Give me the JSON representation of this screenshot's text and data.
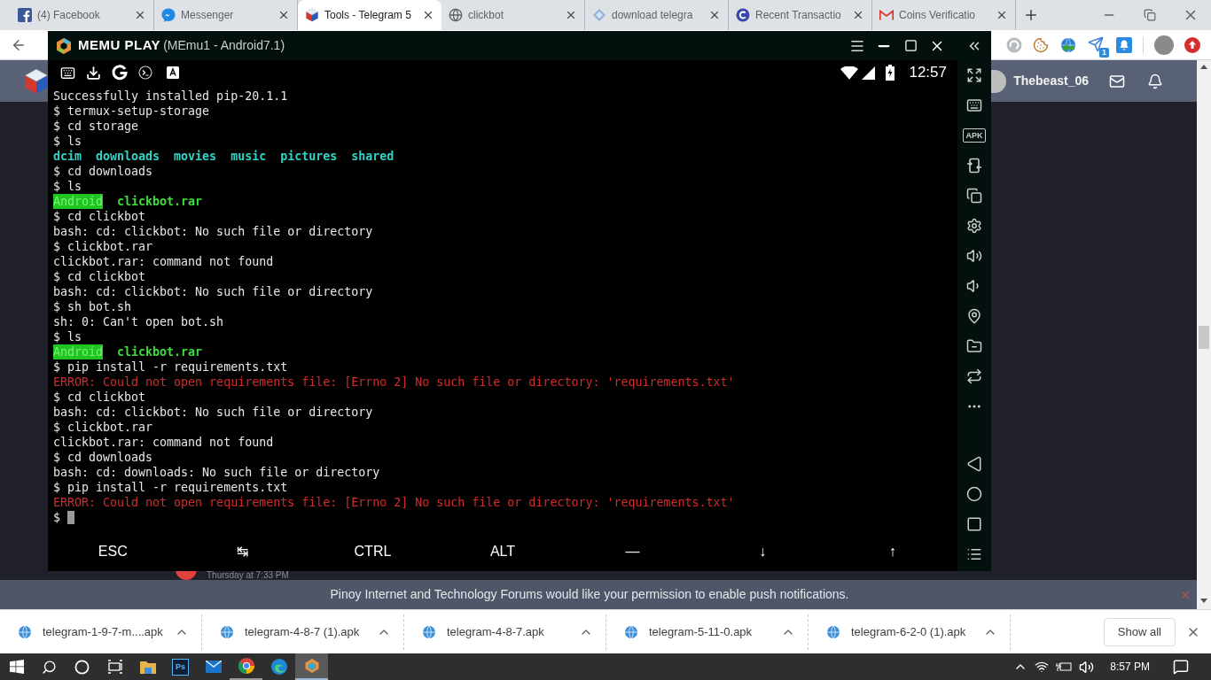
{
  "browser": {
    "tabs": [
      {
        "title": "(4) Facebook",
        "selected": false
      },
      {
        "title": "Messenger",
        "selected": false
      },
      {
        "title": "Tools - Telegram 5",
        "selected": true
      },
      {
        "title": "clickbot",
        "selected": false
      },
      {
        "title": "download telegra",
        "selected": false
      },
      {
        "title": "Recent Transactio",
        "selected": false
      },
      {
        "title": "Coins Verificatio",
        "selected": false
      }
    ],
    "extension_badge": "1"
  },
  "forum": {
    "username": "Thebeast_06",
    "post_time": "Thursday at 7:33 PM",
    "notification": "Pinoy Internet and Technology Forums would like your permission to enable push notifications."
  },
  "emulator": {
    "brand": "MEMU PLAY",
    "title": "(MEmu1 - Android7.1)",
    "clock": "12:57",
    "apk_label": "APK",
    "terminal": [
      {
        "kind": "plain",
        "text": "Successfully installed pip-20.1.1"
      },
      {
        "kind": "plain",
        "text": "$ termux-setup-storage"
      },
      {
        "kind": "plain",
        "text": "$ cd storage"
      },
      {
        "kind": "plain",
        "text": "$ ls"
      },
      {
        "kind": "listing",
        "entries": [
          {
            "kind": "dir",
            "name": "dcim"
          },
          {
            "kind": "dir",
            "name": "downloads"
          },
          {
            "kind": "dir",
            "name": "movies"
          },
          {
            "kind": "dir",
            "name": "music"
          },
          {
            "kind": "dir",
            "name": "pictures"
          },
          {
            "kind": "dir",
            "name": "shared"
          }
        ]
      },
      {
        "kind": "plain",
        "text": "$ cd downloads"
      },
      {
        "kind": "plain",
        "text": "$ ls"
      },
      {
        "kind": "listing",
        "entries": [
          {
            "kind": "highlighted",
            "name": "Android"
          },
          {
            "kind": "archive",
            "name": "clickbot.rar"
          }
        ]
      },
      {
        "kind": "plain",
        "text": "$ cd clickbot"
      },
      {
        "kind": "plain",
        "text": "bash: cd: clickbot: No such file or directory"
      },
      {
        "kind": "plain",
        "text": "$ clickbot.rar"
      },
      {
        "kind": "plain",
        "text": "clickbot.rar: command not found"
      },
      {
        "kind": "plain",
        "text": "$ cd clickbot"
      },
      {
        "kind": "plain",
        "text": "bash: cd: clickbot: No such file or directory"
      },
      {
        "kind": "plain",
        "text": "$ sh bot.sh"
      },
      {
        "kind": "plain",
        "text": "sh: 0: Can't open bot.sh"
      },
      {
        "kind": "plain",
        "text": "$ ls"
      },
      {
        "kind": "listing",
        "entries": [
          {
            "kind": "highlighted",
            "name": "Android"
          },
          {
            "kind": "archive",
            "name": "clickbot.rar"
          }
        ]
      },
      {
        "kind": "plain",
        "text": "$ pip install -r requirements.txt"
      },
      {
        "kind": "error",
        "text": "ERROR: Could not open requirements file: [Errno 2] No such file or directory: 'requirements.txt'"
      },
      {
        "kind": "plain",
        "text": "$ cd clickbot"
      },
      {
        "kind": "plain",
        "text": "bash: cd: clickbot: No such file or directory"
      },
      {
        "kind": "plain",
        "text": "$ clickbot.rar"
      },
      {
        "kind": "plain",
        "text": "clickbot.rar: command not found"
      },
      {
        "kind": "plain",
        "text": "$ cd downloads"
      },
      {
        "kind": "plain",
        "text": "bash: cd: downloads: No such file or directory"
      },
      {
        "kind": "plain",
        "text": "$ pip install -r requirements.txt"
      },
      {
        "kind": "error",
        "text": "ERROR: Could not open requirements file: [Errno 2] No such file or directory: 'requirements.txt'"
      },
      {
        "kind": "prompt",
        "text": "$"
      }
    ],
    "extra_keys": [
      "ESC",
      "↹",
      "CTRL",
      "ALT",
      "—",
      "↓",
      "↑"
    ]
  },
  "downloads": {
    "files": [
      "telegram-1-9-7-m....apk",
      "telegram-4-8-7 (1).apk",
      "telegram-4-8-7.apk",
      "telegram-5-11-0.apk",
      "telegram-6-2-0 (1).apk"
    ],
    "show_all": "Show all"
  },
  "taskbar": {
    "ps_label": "Ps",
    "apps": [
      {
        "running": false,
        "focused": false
      },
      {
        "running": false,
        "focused": false
      },
      {
        "running": false,
        "focused": false
      },
      {
        "running": true,
        "focused": false
      },
      {
        "running": false,
        "focused": false
      },
      {
        "running": true,
        "focused": true
      }
    ],
    "clock": "8:57 PM"
  }
}
